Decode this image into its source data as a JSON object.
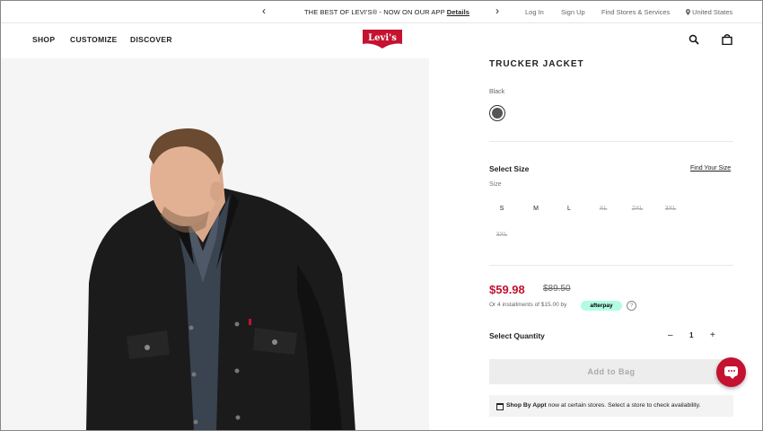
{
  "promo": {
    "message": "THE BEST OF LEVI'S® - NOW ON OUR APP",
    "details_link": "Details",
    "prev_arrow": "‹",
    "next_arrow": "›"
  },
  "utility_nav": {
    "login": "Log In",
    "signup": "Sign Up",
    "find_stores": "Find Stores & Services",
    "country": "United States"
  },
  "main_nav": {
    "shop": "SHOP",
    "customize": "CUSTOMIZE",
    "discover": "DISCOVER"
  },
  "brand": {
    "logo_text": "Levi's",
    "logo_color": "#c41230"
  },
  "icons": {
    "search": "search-icon",
    "bag": "shopping-bag-icon",
    "location": "location-pin-icon",
    "calendar": "calendar-icon",
    "chat": "chat-icon"
  },
  "product": {
    "title": "TRUCKER JACKET",
    "color_name": "Black",
    "swatch_color": "#555555",
    "size_heading": "Select Size",
    "find_size_link": "Find Your Size",
    "size_label": "Size",
    "sizes": [
      {
        "label": "S",
        "available": true
      },
      {
        "label": "M",
        "available": true
      },
      {
        "label": "L",
        "available": true
      },
      {
        "label": "XL",
        "available": false
      },
      {
        "label": "2XL",
        "available": false
      },
      {
        "label": "3XL",
        "available": false
      },
      {
        "label": "3XL",
        "available": false
      }
    ],
    "sale_price": "$59.98",
    "original_price": "$89.50",
    "installments_text": "Or 4 installments of $15.00 by",
    "afterpay_badge": "afterpay",
    "info_icon": "?",
    "quantity_heading": "Select Quantity",
    "quantity": "1",
    "minus": "–",
    "plus": "+",
    "add_to_bag": "Add to Bag",
    "appt_bold": "Shop By Appt",
    "appt_text": "now at certain stores. Select a store to check availability."
  },
  "colors": {
    "accent_red": "#c41230",
    "afterpay_mint": "#b2fce4"
  }
}
